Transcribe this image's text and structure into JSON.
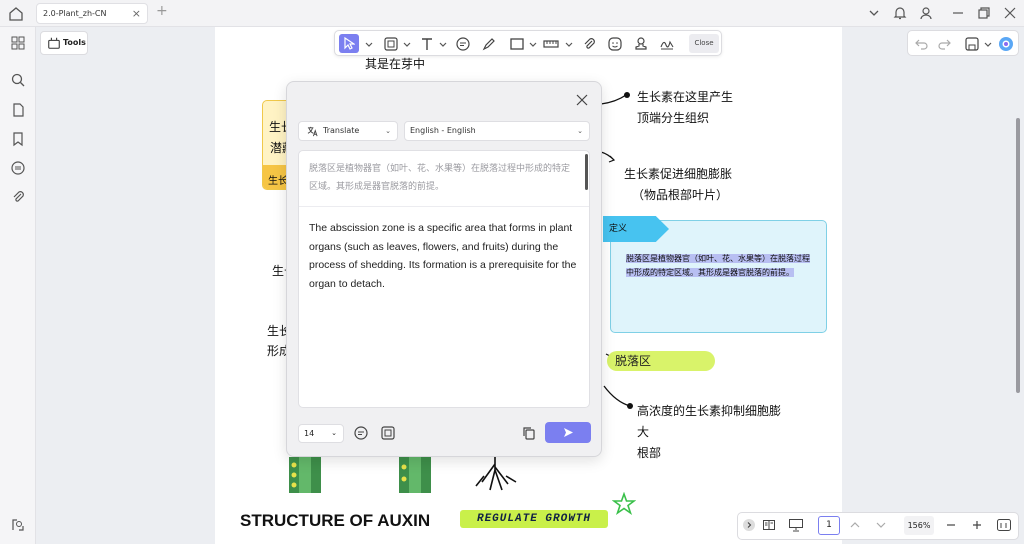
{
  "window": {
    "tab_title": "2.0-Plant_zh-CN",
    "tab_close": "×",
    "new_tab": "+"
  },
  "tools": {
    "label": "Tools"
  },
  "toolbar": {
    "close_label": "Close"
  },
  "document": {
    "texts": {
      "t1": "其是在芽中",
      "t2": "生长素在这里产生",
      "t3": "顶端分生组织",
      "t4": "生长素促进细胞膨胀",
      "t5": "（物品根部叶片）",
      "t6": "生长",
      "t7": "潜藏",
      "t8": "生长",
      "t9": "生长",
      "t10": "生长",
      "t11": "形成",
      "t12": "高浓度的生长素抑制细胞膨",
      "t13": "大",
      "t14": "根部"
    },
    "definition": {
      "tag": "定义",
      "text": "脱落区是植物器官（如叶、花、水果等）在脱落过程中形成的特定区域。其形成是器官脱落的前提。"
    },
    "pill": "脱落区",
    "structure_title": "STRUCTURE OF AUXIN",
    "regulate_label": "REGULATE GROWTH"
  },
  "translate_dialog": {
    "mode": "Translate",
    "language": "English - English",
    "source_text": "脱落区是植物器官（如叶、花、水果等）在脱落过程中形成的特定区域。其形成是器官脱落的前提。",
    "translated_text": "The abscission zone is a specific area that forms in plant organs (such as leaves, flowers, and fruits) during the process of shedding. Its formation is a prerequisite for the organ to detach.",
    "font_size": "14"
  },
  "navigation": {
    "page_number": "1",
    "zoom": "156%"
  },
  "colors": {
    "accent": "#7b7ff0",
    "definition_tag": "#47c3f0",
    "definition_bg": "#dff4fb",
    "pill": "#d9f36a",
    "note_yellow": "#f6c545"
  }
}
